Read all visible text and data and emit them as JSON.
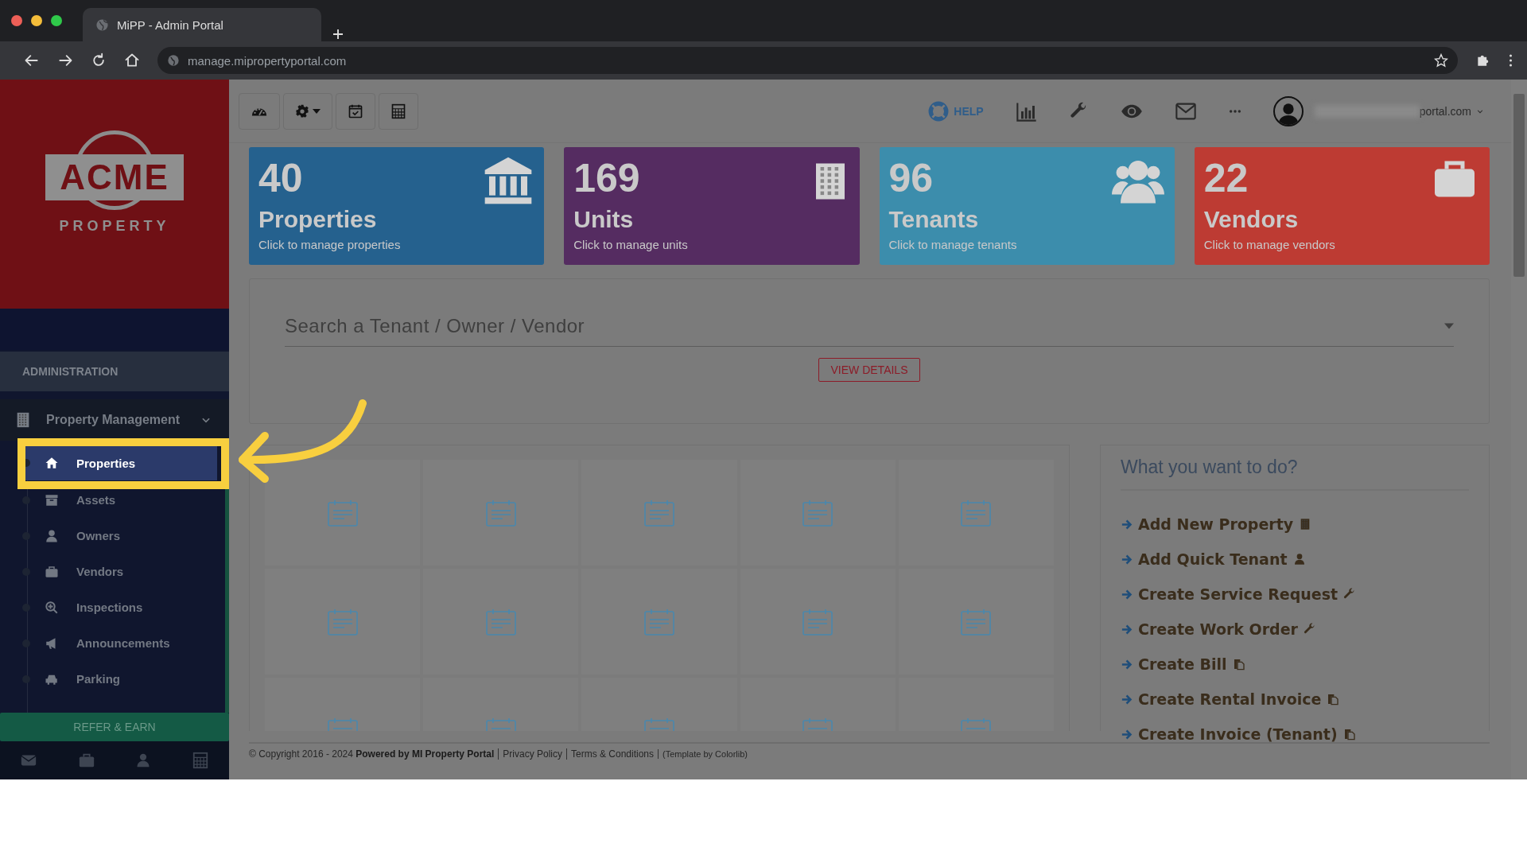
{
  "browser": {
    "tab_title": "MiPP - Admin Portal",
    "url": "manage.mipropertyportal.com"
  },
  "header": {
    "help": "HELP",
    "user_email": "portal.com"
  },
  "sidebar": {
    "logo": {
      "name": "ACME",
      "tagline": "PROPERTY"
    },
    "section": "ADMINISTRATION",
    "group": {
      "label": "Property Management",
      "expanded": true
    },
    "items": [
      {
        "label": "Properties",
        "kind": "home",
        "selected": true
      },
      {
        "label": "Assets",
        "kind": "archive",
        "selected": false
      },
      {
        "label": "Owners",
        "kind": "user",
        "selected": false
      },
      {
        "label": "Vendors",
        "kind": "briefcase",
        "selected": false
      },
      {
        "label": "Inspections",
        "kind": "search-plus",
        "selected": false
      },
      {
        "label": "Announcements",
        "kind": "bullhorn",
        "selected": false
      },
      {
        "label": "Parking",
        "kind": "car",
        "selected": false
      }
    ],
    "refer": "REFER & EARN"
  },
  "stats": [
    {
      "value": "40",
      "label": "Properties",
      "hint": "Click to manage properties",
      "kind": "bank",
      "color": "#25618e"
    },
    {
      "value": "169",
      "label": "Units",
      "hint": "Click to manage units",
      "kind": "building",
      "color": "#552c61"
    },
    {
      "value": "96",
      "label": "Tenants",
      "hint": "Click to manage tenants",
      "kind": "users",
      "color": "#3c8dac"
    },
    {
      "value": "22",
      "label": "Vendors",
      "hint": "Click to manage vendors",
      "kind": "briefcase",
      "color": "#bd3b33"
    }
  ],
  "search": {
    "placeholder": "Search a Tenant / Owner / Vendor",
    "button": "VIEW DETAILS"
  },
  "actions": {
    "title": "What you want to do?",
    "items": [
      {
        "label": "Add New Property",
        "kind": "building"
      },
      {
        "label": "Add Quick Tenant",
        "kind": "user"
      },
      {
        "label": "Create Service Request",
        "kind": "wrench"
      },
      {
        "label": "Create Work Order",
        "kind": "wrench"
      },
      {
        "label": "Create Bill",
        "kind": "copy"
      },
      {
        "label": "Create Rental Invoice",
        "kind": "copy"
      },
      {
        "label": "Create Invoice (Tenant)",
        "kind": "copy"
      }
    ]
  },
  "footer": {
    "copyright": "© Copyright 2016 - 2024 **Powered by MI Property Portal**",
    "links": [
      "Privacy Policy",
      "Terms & Conditions"
    ],
    "credit": "(Template by Colorlib)"
  }
}
